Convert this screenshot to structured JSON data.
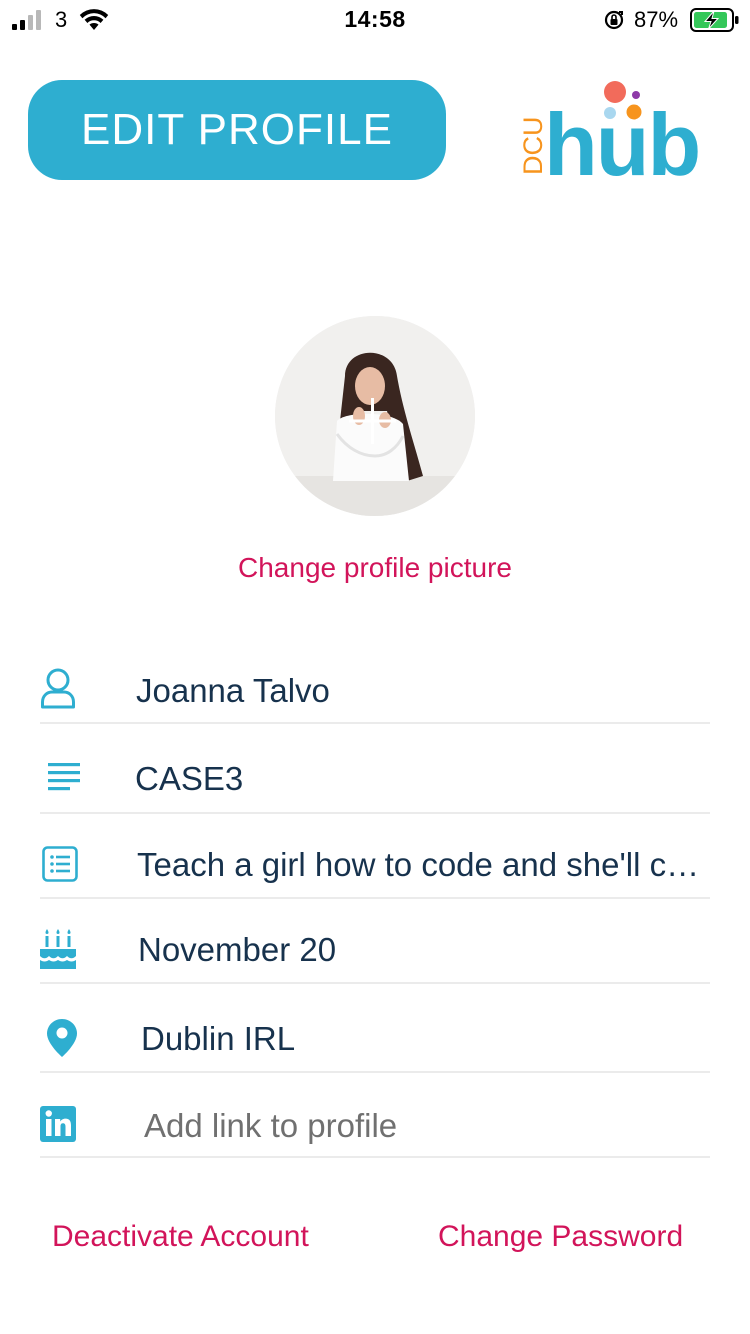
{
  "status_bar": {
    "carrier": "3",
    "time": "14:58",
    "battery_percent": "87%",
    "icons": [
      "signal-icon",
      "wifi-icon",
      "orientation-lock-icon",
      "battery-charging-icon"
    ]
  },
  "header": {
    "edit_profile_label": "EDIT PROFILE",
    "logo": {
      "prefix": "DCU",
      "word": "hub"
    }
  },
  "avatar": {
    "change_picture_label": "Change profile picture",
    "overlay_icon": "plus-icon"
  },
  "fields": {
    "name": {
      "icon": "user-icon",
      "value": "Joanna Talvo"
    },
    "course": {
      "icon": "lines-icon",
      "value": "CASE3"
    },
    "bio": {
      "icon": "list-icon",
      "value": "Teach a girl how to code and she'll change the world"
    },
    "birthday": {
      "icon": "cake-icon",
      "value": "November 20"
    },
    "location": {
      "icon": "location-pin-icon",
      "value": "Dublin IRL"
    },
    "link": {
      "icon": "linkedin-icon",
      "placeholder": "Add link to profile"
    }
  },
  "actions": {
    "deactivate_label": "Deactivate Account",
    "change_password_label": "Change Password"
  },
  "colors": {
    "accent": "#2eaed0",
    "link": "#d2145a",
    "text": "#17324d",
    "logo_orange": "#f7941d"
  }
}
